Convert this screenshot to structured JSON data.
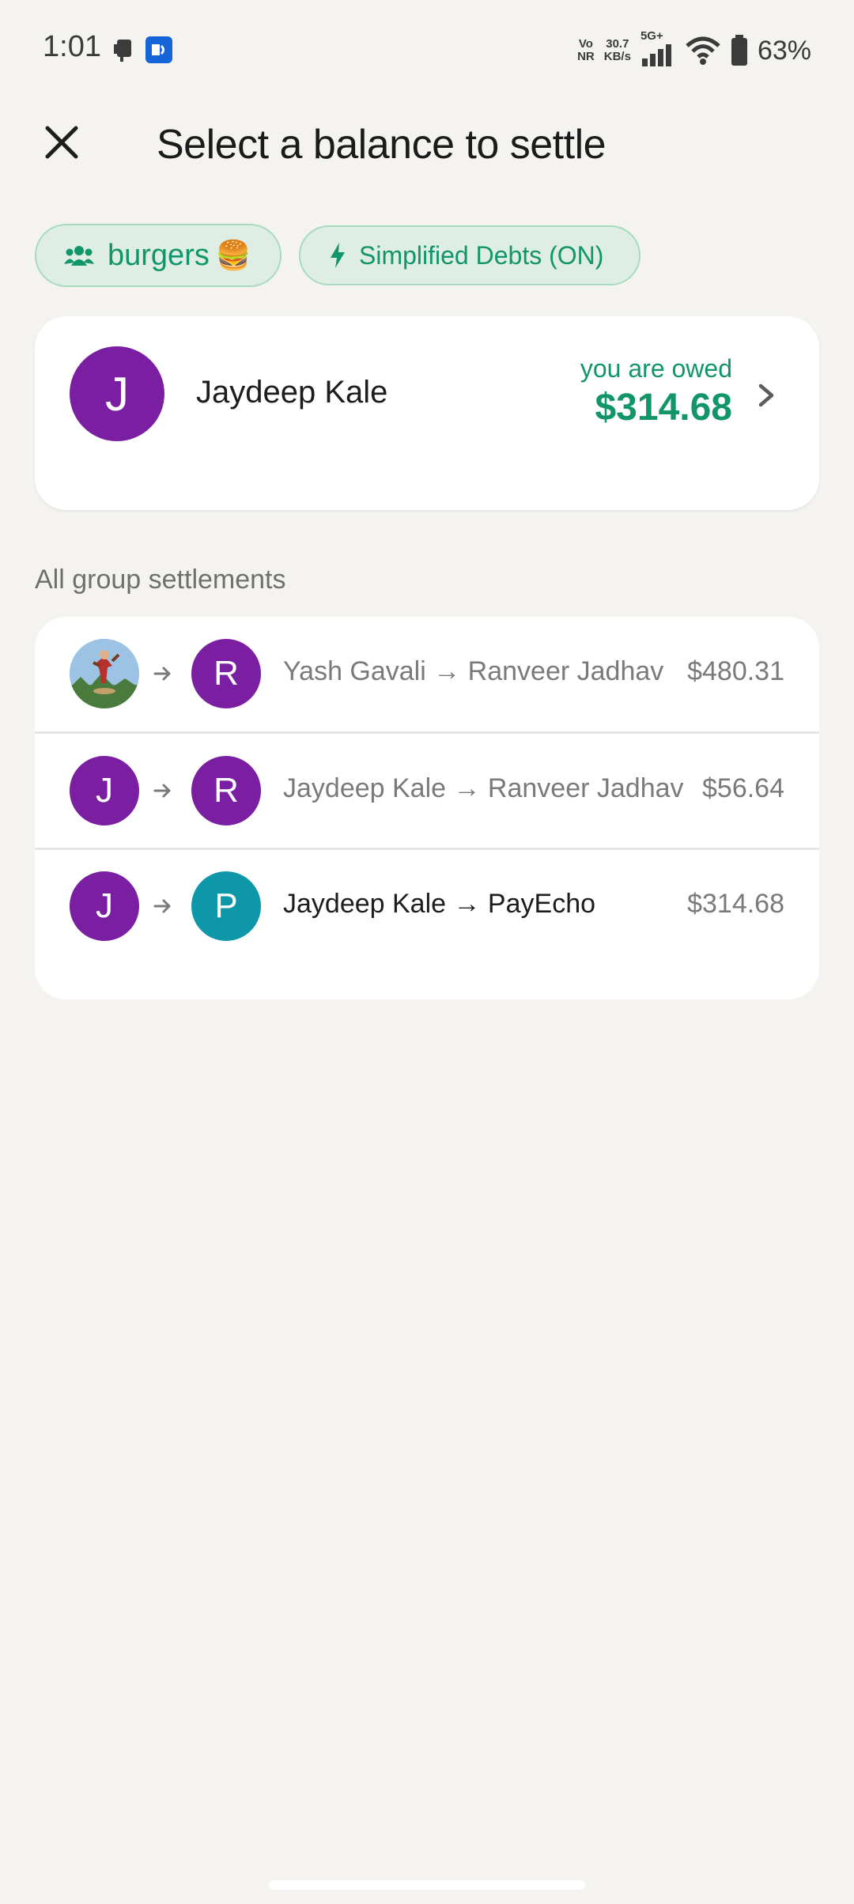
{
  "status_bar": {
    "time": "1:01",
    "network_top": "Vo",
    "network_bottom": "NR",
    "speed_value": "30.7",
    "speed_unit": "KB/s",
    "signal_type": "5G+",
    "battery": "63%"
  },
  "header": {
    "title": "Select a balance to settle"
  },
  "chips": {
    "group_name": "burgers",
    "group_emoji": "🍔",
    "debts_label": "Simplified Debts (ON)"
  },
  "balance": {
    "avatar_letter": "J",
    "name": "Jaydeep Kale",
    "status_label": "you are owed",
    "amount": "$314.68"
  },
  "settlements": {
    "section_title": "All group settlements",
    "rows": [
      {
        "to_letter": "R",
        "text": "Yash Gavali → Ranveer Jadhav",
        "amount": "$480.31"
      },
      {
        "from_letter": "J",
        "to_letter": "R",
        "text": "Jaydeep Kale → Ranveer Jadhav",
        "amount": "$56.64"
      },
      {
        "from_letter": "J",
        "to_letter": "P",
        "text": "Jaydeep Kale → PayEcho",
        "amount": "$314.68"
      }
    ]
  },
  "colors": {
    "accent_green": "#12956a",
    "avatar_purple": "#7a1fa2",
    "avatar_teal": "#0e97a8",
    "background": "#f4f3ef"
  }
}
